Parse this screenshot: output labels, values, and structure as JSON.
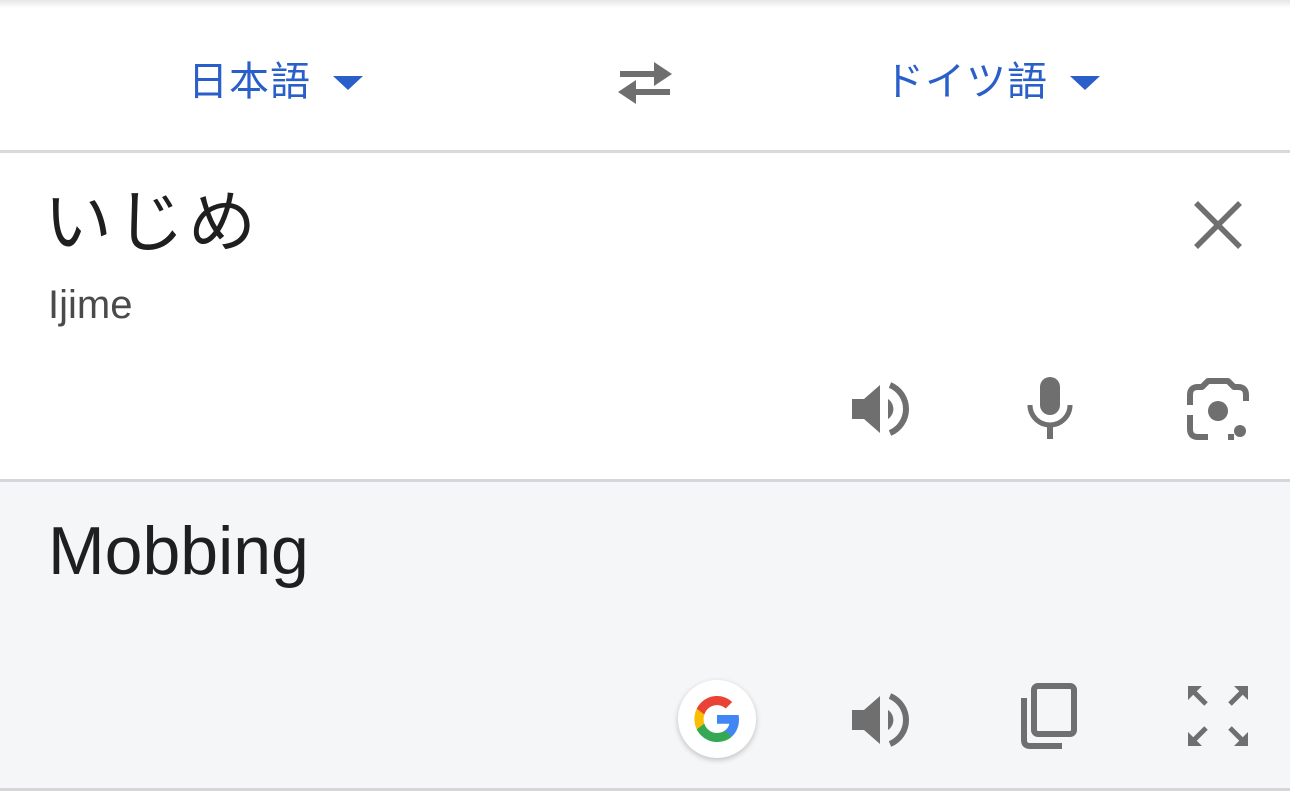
{
  "languages": {
    "source_label": "日本語",
    "target_label": "ドイツ語"
  },
  "source": {
    "text": "いじめ",
    "romanization": "Ijime"
  },
  "result": {
    "text": "Mobbing"
  },
  "icons": {
    "dropdown": "caret-down-icon",
    "swap": "swap-arrows-icon",
    "clear": "close-icon",
    "speaker": "speaker-icon",
    "microphone": "microphone-icon",
    "camera": "camera-lens-icon",
    "google": "google-g-icon",
    "copy": "copy-icon",
    "fullscreen": "fullscreen-icon"
  },
  "colors": {
    "accent": "#2a5fc9",
    "icon_gray": "#6f6f6f",
    "result_bg": "#f5f6f8"
  }
}
